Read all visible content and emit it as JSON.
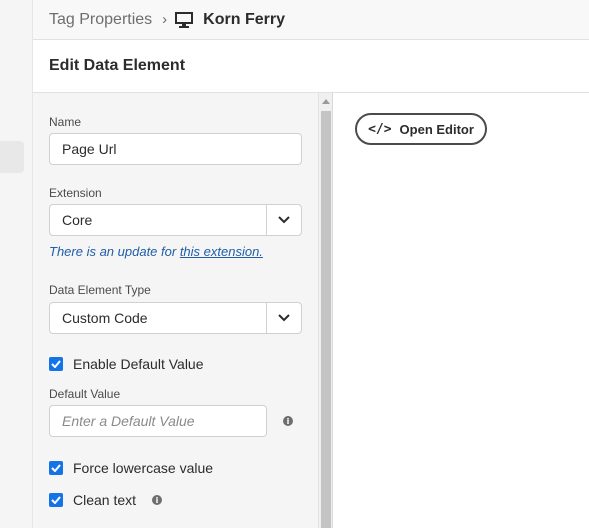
{
  "breadcrumb": {
    "parent": "Tag Properties",
    "separator": "›",
    "current": "Korn Ferry",
    "current_icon": "monitor-icon"
  },
  "header": {
    "title": "Edit Data Element"
  },
  "form": {
    "name": {
      "label": "Name",
      "value": "Page Url"
    },
    "extension": {
      "label": "Extension",
      "value": "Core",
      "update_text": "There is an update for ",
      "update_link": "this extension."
    },
    "type": {
      "label": "Data Element Type",
      "value": "Custom Code"
    },
    "enable_default": {
      "label": "Enable Default Value",
      "checked": true
    },
    "default_value": {
      "label": "Default Value",
      "placeholder": "Enter a Default Value"
    },
    "force_lowercase": {
      "label": "Force lowercase value",
      "checked": true
    },
    "clean_text": {
      "label": "Clean text",
      "checked": true
    }
  },
  "editor": {
    "open_label": "Open Editor",
    "open_icon": "code-icon",
    "code_glyph": "</>"
  },
  "colors": {
    "accent": "#1473e6",
    "link": "#1f5ea8"
  }
}
